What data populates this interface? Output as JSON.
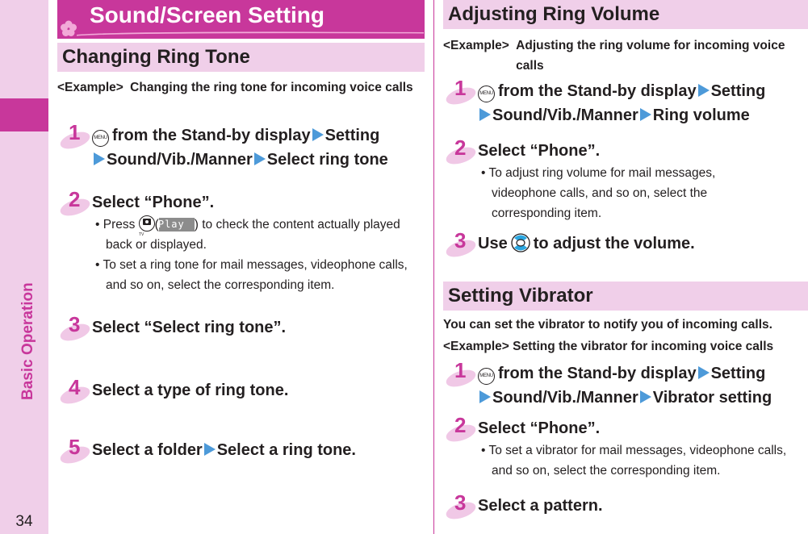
{
  "sidebar": {
    "section_label": "Basic Operation",
    "page_number": "34",
    "accent_color": "#c8379b",
    "strip_color": "#f0cfe9"
  },
  "header": {
    "title": "Sound/Screen Setting",
    "icon": "flower-icon"
  },
  "left_column": {
    "heading": "Changing Ring Tone",
    "example_tag": "<Example>",
    "example_text": "Changing the ring tone for incoming voice calls",
    "steps": [
      {
        "num": "1",
        "key_icon": "menu-key-icon",
        "key_label": "MENU",
        "path": [
          "from the Stand-by display",
          "Setting",
          "Sound/Vib./Manner",
          "Select ring tone"
        ]
      },
      {
        "num": "2",
        "main": "Select “Phone”.",
        "bullets": [
          {
            "prefix": "• Press ",
            "key_icon": "camera-tv-key-icon",
            "softkey": "Play",
            "suffix": ") to check the content actually played back or displayed."
          },
          {
            "text": "• To set a ring tone for mail messages, videophone calls, and so on, select the corresponding item."
          }
        ]
      },
      {
        "num": "3",
        "main": "Select “Select ring tone”."
      },
      {
        "num": "4",
        "main": "Select a type of ring tone."
      },
      {
        "num": "5",
        "path": [
          "Select a folder",
          "Select a ring tone."
        ]
      }
    ]
  },
  "right_column": {
    "volume": {
      "heading": "Adjusting Ring Volume",
      "example_tag": "<Example>",
      "example_text": "Adjusting the ring volume for incoming voice calls",
      "steps": [
        {
          "num": "1",
          "key_label": "MENU",
          "path": [
            "from the Stand-by display",
            "Setting",
            "Sound/Vib./Manner",
            "Ring volume"
          ]
        },
        {
          "num": "2",
          "main": "Select “Phone”.",
          "bullet": "• To adjust ring volume for mail messages, videophone calls, and so on, select the corresponding item."
        },
        {
          "num": "3",
          "main_before": "Use",
          "key_icon": "navigation-key-icon",
          "main_after": "to adjust the volume."
        }
      ]
    },
    "vibrator": {
      "heading": "Setting Vibrator",
      "intro": "You can set the vibrator to notify you of incoming calls.",
      "example_tag": "<Example>",
      "example_text": "Setting the vibrator for incoming voice calls",
      "steps": [
        {
          "num": "1",
          "key_label": "MENU",
          "path": [
            "from the Stand-by display",
            "Setting",
            "Sound/Vib./Manner",
            "Vibrator setting"
          ]
        },
        {
          "num": "2",
          "main": "Select “Phone”.",
          "bullet": "• To set a vibrator for mail messages, videophone calls, and so on, select the corresponding item."
        },
        {
          "num": "3",
          "main": "Select a pattern."
        }
      ]
    }
  }
}
